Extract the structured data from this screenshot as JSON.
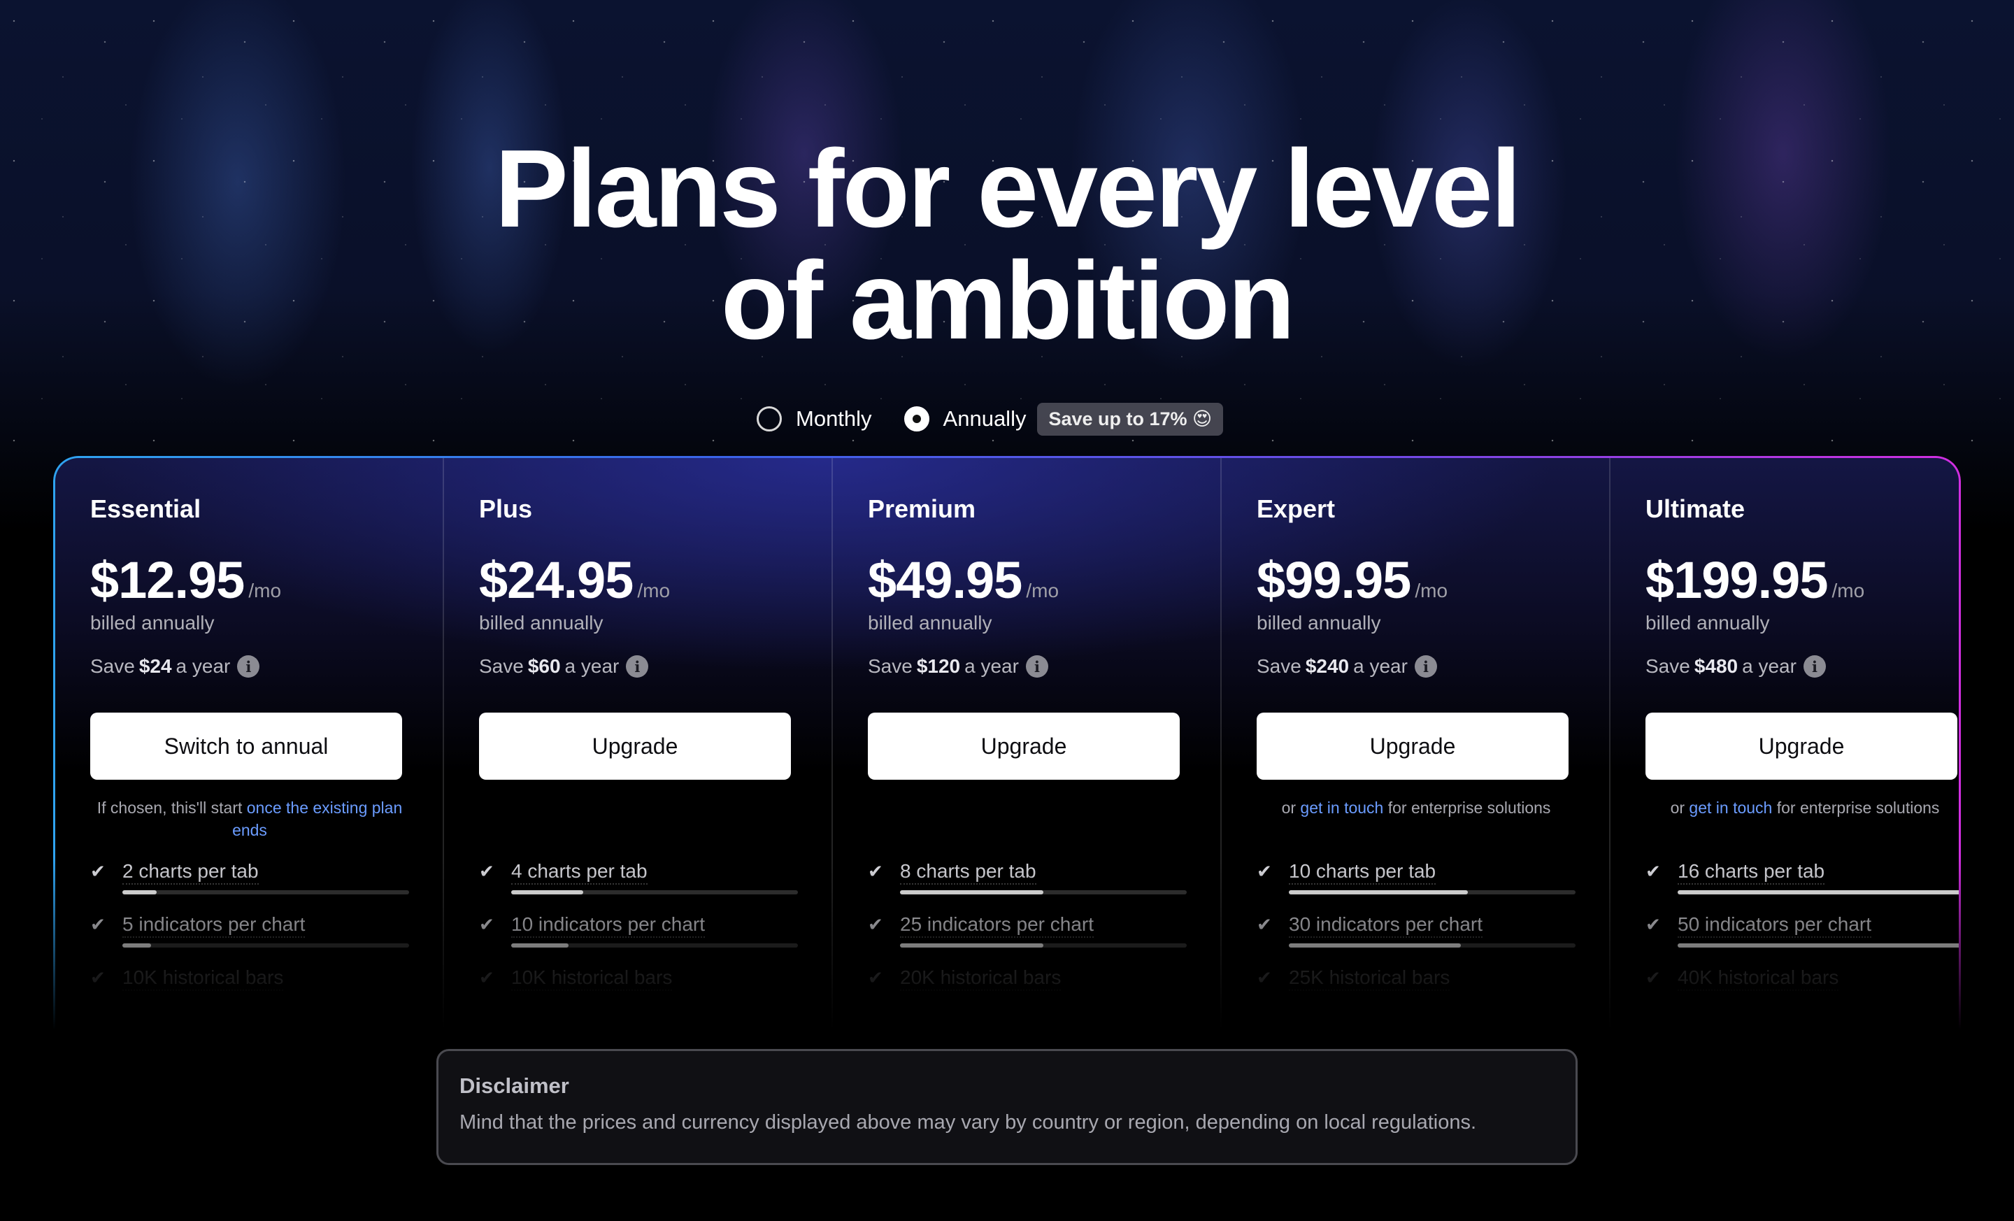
{
  "hero": {
    "title_line1": "Plans for every level",
    "title_line2": "of ambition"
  },
  "billing": {
    "monthly_label": "Monthly",
    "annually_label": "Annually",
    "selected": "Annually",
    "save_badge": "Save up to 17% 😍"
  },
  "plans": [
    {
      "name": "Essential",
      "price": "$12.95",
      "per": "/mo",
      "billed": "billed annually",
      "save_prefix": "Save",
      "save_amount": "$24",
      "save_suffix": "a year",
      "cta": "Switch to annual",
      "note_text": "If chosen, this'll start",
      "note_link": "once the existing plan ends",
      "features": [
        {
          "label": "2 charts per tab",
          "level": 0.12
        },
        {
          "label": "5 indicators per chart",
          "level": 0.1
        },
        {
          "label": "10K historical bars"
        }
      ]
    },
    {
      "name": "Plus",
      "price": "$24.95",
      "per": "/mo",
      "billed": "billed annually",
      "save_prefix": "Save",
      "save_amount": "$60",
      "save_suffix": "a year",
      "cta": "Upgrade",
      "features": [
        {
          "label": "4 charts per tab",
          "level": 0.25
        },
        {
          "label": "10 indicators per chart",
          "level": 0.2
        },
        {
          "label": "10K historical bars"
        }
      ]
    },
    {
      "name": "Premium",
      "price": "$49.95",
      "per": "/mo",
      "billed": "billed annually",
      "save_prefix": "Save",
      "save_amount": "$120",
      "save_suffix": "a year",
      "cta": "Upgrade",
      "features": [
        {
          "label": "8 charts per tab",
          "level": 0.5
        },
        {
          "label": "25 indicators per chart",
          "level": 0.5
        },
        {
          "label": "20K historical bars"
        }
      ]
    },
    {
      "name": "Expert",
      "price": "$99.95",
      "per": "/mo",
      "billed": "billed annually",
      "save_prefix": "Save",
      "save_amount": "$240",
      "save_suffix": "a year",
      "cta": "Upgrade",
      "note_pre": "or",
      "note_link": "get in touch",
      "note_post": "for enterprise solutions",
      "features": [
        {
          "label": "10 charts per tab",
          "level": 0.625
        },
        {
          "label": "30 indicators per chart",
          "level": 0.6
        },
        {
          "label": "25K historical bars"
        }
      ]
    },
    {
      "name": "Ultimate",
      "price": "$199.95",
      "per": "/mo",
      "billed": "billed annually",
      "save_prefix": "Save",
      "save_amount": "$480",
      "save_suffix": "a year",
      "cta": "Upgrade",
      "note_pre": "or",
      "note_link": "get in touch",
      "note_post": "for enterprise solutions",
      "features": [
        {
          "label": "16 charts per tab",
          "level": 1.0
        },
        {
          "label": "50 indicators per chart",
          "level": 1.0
        },
        {
          "label": "40K historical bars"
        }
      ]
    }
  ],
  "disclaimer": {
    "title": "Disclaimer",
    "text": "Mind that the prices and currency displayed above may vary by country or region, depending on local regulations."
  },
  "icons": {
    "check": "check-icon",
    "info": "info-icon",
    "radio": "radio-icon"
  }
}
